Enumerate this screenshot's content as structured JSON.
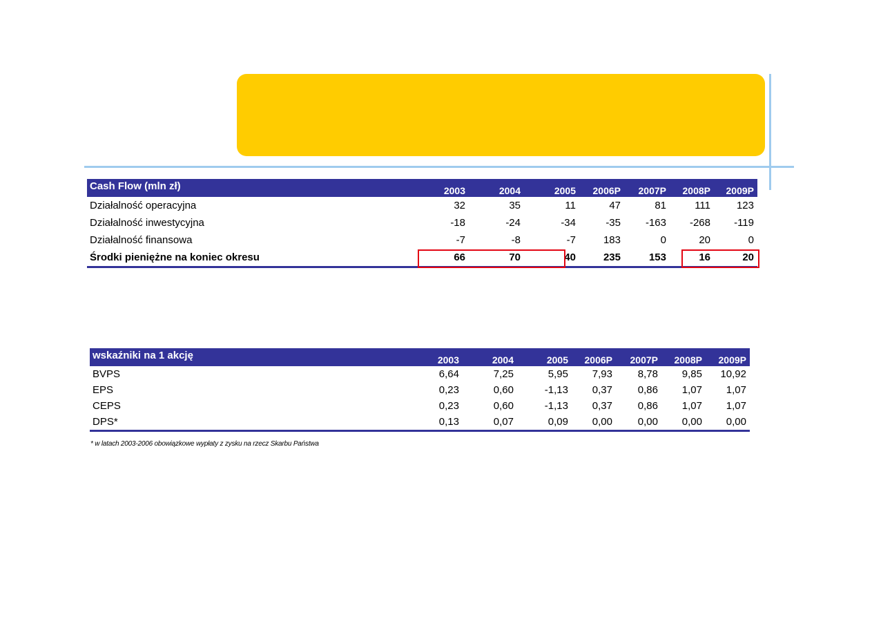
{
  "cash_flow": {
    "title": "Cash Flow (mln zł)",
    "years": [
      "2003",
      "2004",
      "2005",
      "2006P",
      "2007P",
      "2008P",
      "2009P"
    ],
    "rows": [
      {
        "label": "Działalność operacyjna",
        "values": [
          "32",
          "35",
          "11",
          "47",
          "81",
          "111",
          "123"
        ]
      },
      {
        "label": "Działalność inwestycyjna",
        "values": [
          "-18",
          "-24",
          "-34",
          "-35",
          "-163",
          "-268",
          "-119"
        ]
      },
      {
        "label": "Działalność finansowa",
        "values": [
          "-7",
          "-8",
          "-7",
          "183",
          "0",
          "20",
          "0"
        ]
      },
      {
        "label": "Środki pieniężne na koniec okresu",
        "values": [
          "66",
          "70",
          "40",
          "235",
          "153",
          "16",
          "20"
        ]
      }
    ]
  },
  "per_share": {
    "title": "wskaźniki na 1 akcję",
    "years": [
      "2003",
      "2004",
      "2005",
      "2006P",
      "2007P",
      "2008P",
      "2009P"
    ],
    "rows": [
      {
        "label": "BVPS",
        "values": [
          "6,64",
          "7,25",
          "5,95",
          "7,93",
          "8,78",
          "9,85",
          "10,92"
        ]
      },
      {
        "label": "EPS",
        "values": [
          "0,23",
          "0,60",
          "-1,13",
          "0,37",
          "0,86",
          "1,07",
          "1,07"
        ]
      },
      {
        "label": "CEPS",
        "values": [
          "0,23",
          "0,60",
          "-1,13",
          "0,37",
          "0,86",
          "1,07",
          "1,07"
        ]
      },
      {
        "label": "DPS*",
        "values": [
          "0,13",
          "0,07",
          "0,09",
          "0,00",
          "0,00",
          "0,00",
          "0,00"
        ]
      }
    ],
    "footnote": "* w latach 2003-2006 obowiązkowe wypłaty z zysku na rzecz Skarbu Państwa"
  },
  "colors": {
    "header": "#333399",
    "title_box": "#ffcc00",
    "accent_lines": "#9fcbee",
    "highlight": "#e30613"
  }
}
